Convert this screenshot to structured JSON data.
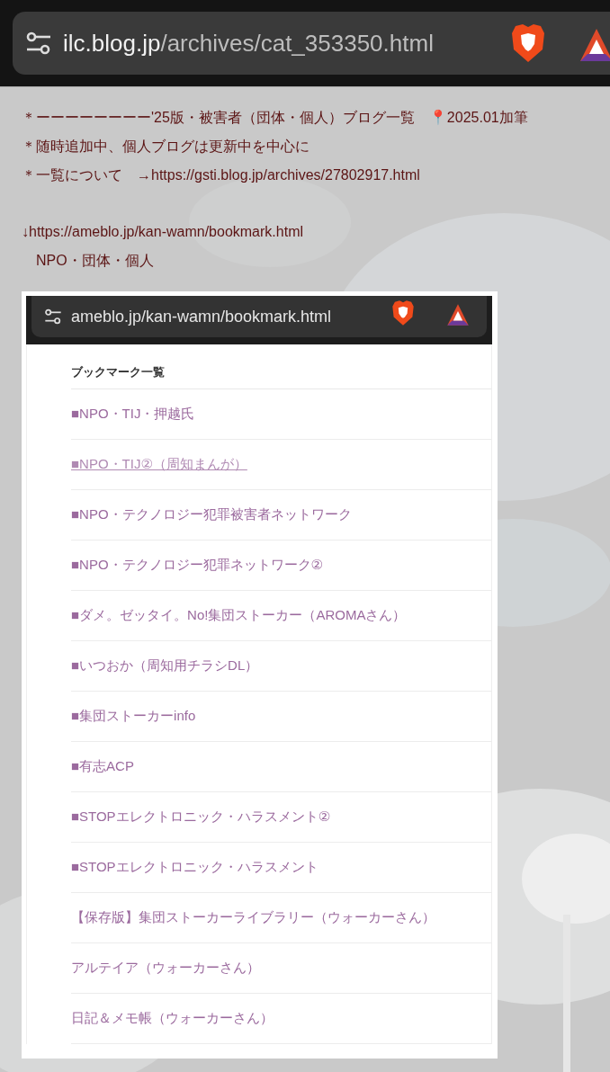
{
  "address_bar": {
    "domain": "ilc.blog.jp",
    "path": "/archives/cat_353350.html"
  },
  "post_paragraphs": [
    {
      "lines": [
        "＊ーーーーーーーー'25版・被害者（団体・個人）ブログ一覧　📍2025.01加筆",
        "＊随時追加中、個人ブログは更新中を中心に",
        "＊一覧について　→https://gsti.blog.jp/archives/27802917.html"
      ]
    },
    {
      "lines": [
        "↓https://ameblo.jp/kan-wamn/bookmark.html",
        "　NPO・団体・個人"
      ]
    }
  ],
  "embedded_screenshot": {
    "address_bar": {
      "url": "ameblo.jp/kan-wamn/bookmark.html"
    },
    "heading": "ブックマーク一覧",
    "items": [
      {
        "label": "■NPO・TIJ・押越氏",
        "underlined": false
      },
      {
        "label": "■NPO・TIJ②（周知まんが）",
        "underlined": true
      },
      {
        "label": "■NPO・テクノロジー犯罪被害者ネットワーク",
        "underlined": false
      },
      {
        "label": "■NPO・テクノロジー犯罪ネットワーク②",
        "underlined": false
      },
      {
        "label": "■ダメ。ゼッタイ。No!集団ストーカー（AROMAさん）",
        "underlined": false
      },
      {
        "label": "■いつおか（周知用チラシDL）",
        "underlined": false
      },
      {
        "label": "■集団ストーカーinfo",
        "underlined": false
      },
      {
        "label": "■有志ACP",
        "underlined": false
      },
      {
        "label": "■STOPエレクトロニック・ハラスメント②",
        "underlined": false
      },
      {
        "label": "■STOPエレクトロニック・ハラスメント",
        "underlined": false
      },
      {
        "label": "【保存版】集団ストーカーライブラリー（ウォーカーさん）",
        "underlined": false
      },
      {
        "label": "アルテイア（ウォーカーさん）",
        "underlined": false
      },
      {
        "label": "日記＆メモ帳（ウォーカーさん）",
        "underlined": false
      }
    ]
  }
}
